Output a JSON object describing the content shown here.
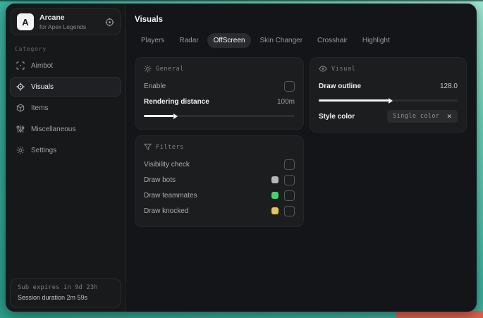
{
  "sidebar": {
    "brand": {
      "logo_letter": "A",
      "name": "Arcane",
      "subtitle": "for Apex Legends"
    },
    "category_label": "Category",
    "items": [
      {
        "label": "Aimbot",
        "icon": "aimbot-icon",
        "selected": false
      },
      {
        "label": "Visuals",
        "icon": "visuals-icon",
        "selected": true
      },
      {
        "label": "Items",
        "icon": "items-icon",
        "selected": false
      },
      {
        "label": "Miscellaneous",
        "icon": "miscellaneous-icon",
        "selected": false
      },
      {
        "label": "Settings",
        "icon": "settings-icon",
        "selected": false
      }
    ],
    "footer": {
      "line1": "Sub expires in 9d 23h",
      "line2": "Session duration 2m 59s"
    }
  },
  "main": {
    "title": "Visuals",
    "tabs": [
      {
        "label": "Players",
        "selected": false
      },
      {
        "label": "Radar",
        "selected": false
      },
      {
        "label": "OffScreen",
        "selected": true
      },
      {
        "label": "Skin Changer",
        "selected": false
      },
      {
        "label": "Crosshair",
        "selected": false
      },
      {
        "label": "Highlight",
        "selected": false
      }
    ],
    "panels": {
      "general": {
        "title": "General",
        "enable": {
          "label": "Enable",
          "checked": false
        },
        "rendering": {
          "label": "Rendering distance",
          "value": "100m",
          "fill": "19.5%"
        }
      },
      "visual": {
        "title": "Visual",
        "outline": {
          "label": "Draw outline",
          "value": "128.0",
          "fill": "50%"
        },
        "style_color": {
          "label": "Style color",
          "selected_option": "Single color",
          "clear_glyph": "✕"
        }
      },
      "filters": {
        "title": "Filters",
        "rows": [
          {
            "label": "Visibility check",
            "swatch": null,
            "checked": false
          },
          {
            "label": "Draw bots",
            "swatch": "#b6b7bb",
            "checked": false
          },
          {
            "label": "Draw teammates",
            "swatch": "#45d36a",
            "checked": false
          },
          {
            "label": "Draw knocked",
            "swatch": "#e2c65a",
            "checked": false
          }
        ]
      }
    }
  },
  "colors": {
    "background_teal": "#3fb3a0",
    "background_mint": "#9ce8d2",
    "background_orange": "#e0614c",
    "window_bg": "#141518",
    "panel_bg": "#1c1d1f",
    "accent_text": "#f2f3f4"
  }
}
